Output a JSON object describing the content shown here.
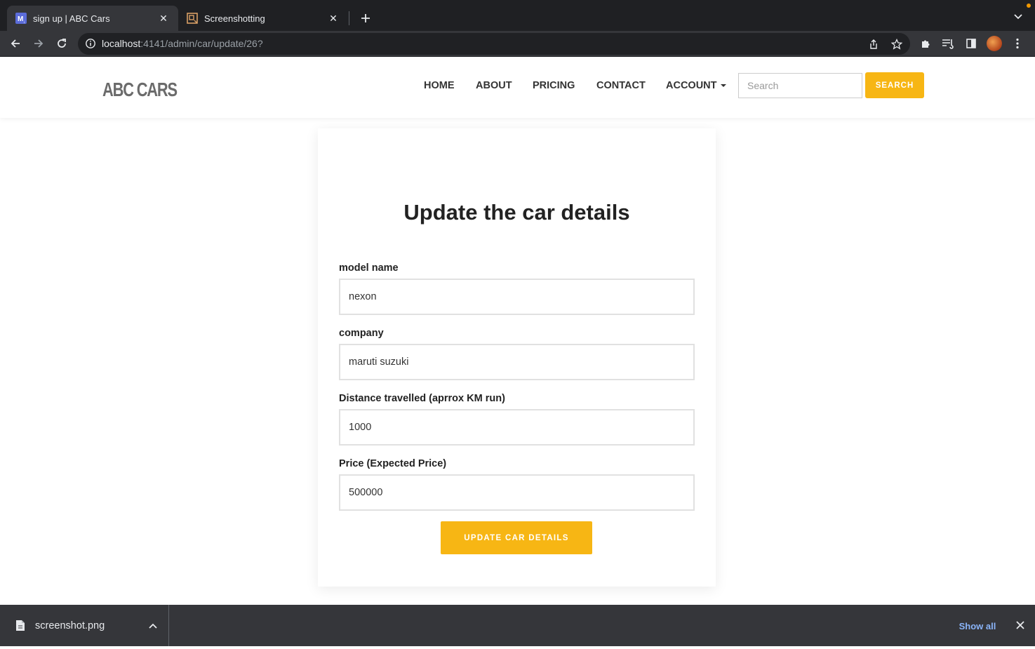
{
  "browser": {
    "tabs": [
      {
        "title": "sign up | ABC Cars",
        "favicon": "markdown-favicon-icon",
        "active": true
      },
      {
        "title": "Screenshotting",
        "favicon": "screenshot-favicon-icon",
        "active": false
      }
    ],
    "url_host": "localhost",
    "url_path": ":4141/admin/car/update/26?"
  },
  "site": {
    "logo": "ABC CARS",
    "nav": {
      "home": "HOME",
      "about": "ABOUT",
      "pricing": "PRICING",
      "contact": "CONTACT",
      "account": "ACCOUNT"
    },
    "search": {
      "placeholder": "Search",
      "button": "SEARCH"
    },
    "accent_color": "#f7b614"
  },
  "form": {
    "title": "Update the car details",
    "fields": [
      {
        "label": "model name",
        "value": "nexon"
      },
      {
        "label": "company",
        "value": "maruti suzuki"
      },
      {
        "label": "Distance travelled (aprrox KM run)",
        "value": "1000"
      },
      {
        "label": "Price (Expected Price)",
        "value": "500000"
      }
    ],
    "submit": "UPDATE CAR DETAILS"
  },
  "downloads": {
    "file_name": "screenshot.png",
    "show_all": "Show all"
  }
}
